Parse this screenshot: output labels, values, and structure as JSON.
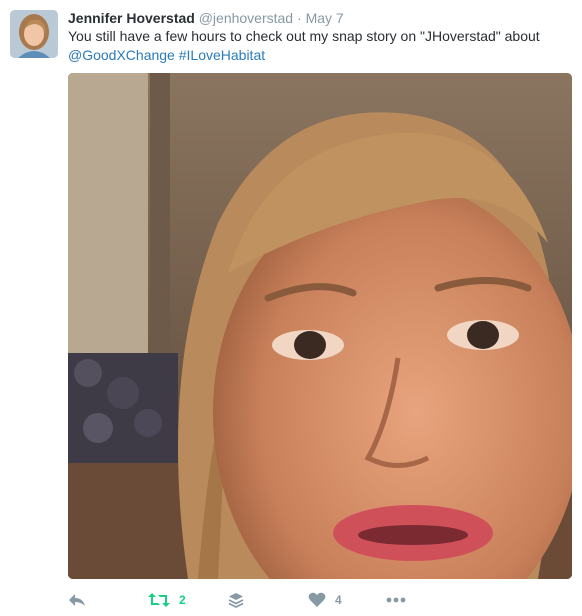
{
  "tweet": {
    "author_name": "Jennifer Hoverstad",
    "author_handle": "@jenhoverstad",
    "separator": "·",
    "date": "May 7",
    "text": "You still have a few hours to check out my snap story on \"JHoverstad\" about",
    "mentions": [
      {
        "text": "@GoodXChange"
      },
      {
        "text": "#ILoveHabitat"
      }
    ]
  },
  "actions": {
    "retweet_count": "2",
    "like_count": "4"
  },
  "icons": {
    "reply": "reply-icon",
    "retweet": "retweet-icon",
    "stack": "layers-icon",
    "like": "heart-icon",
    "more": "more-dots-icon"
  },
  "colors": {
    "link": "#2b7bb9",
    "retweet_active": "#19cf86",
    "muted": "#8899a6",
    "text": "#292f33"
  }
}
